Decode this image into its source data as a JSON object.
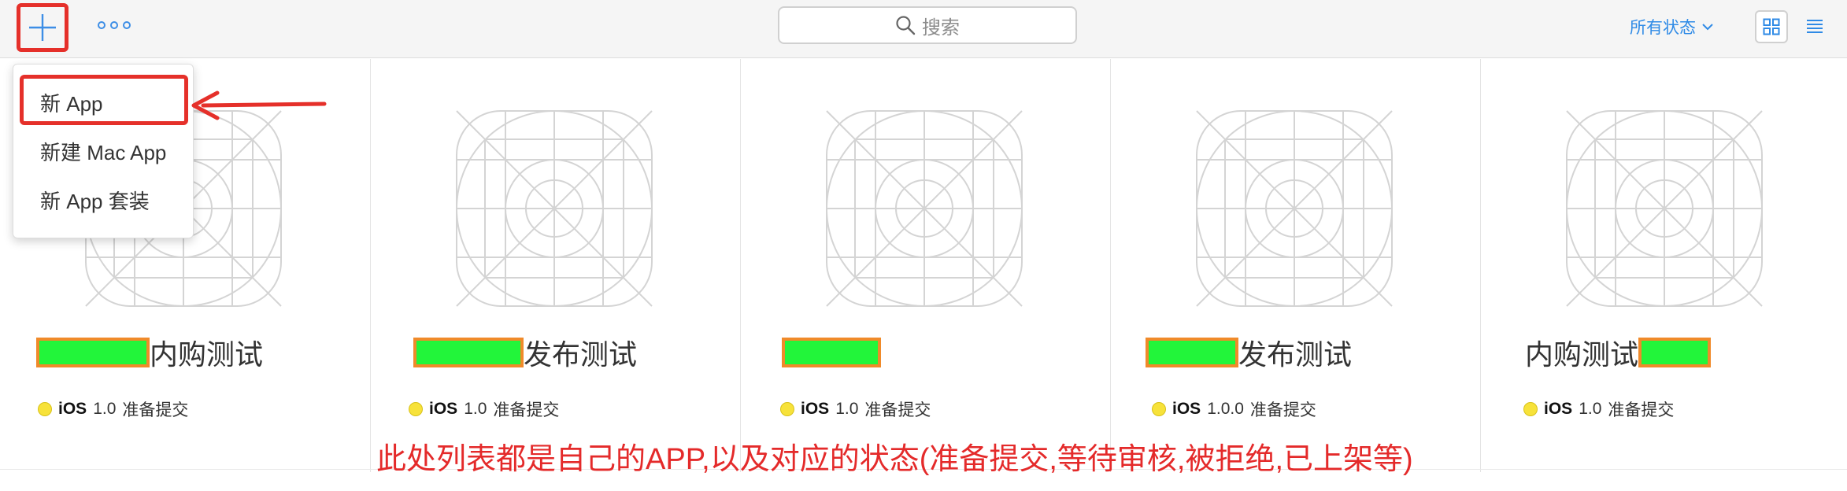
{
  "toolbar": {
    "search_placeholder": "搜索",
    "status_filter_label": "所有状态"
  },
  "new_menu": {
    "items": [
      "新 App",
      "新建 Mac App",
      "新 App 套装"
    ],
    "highlighted_index": 0
  },
  "apps": [
    {
      "name_suffix": "内购测试",
      "platform": "iOS",
      "version": "1.0",
      "status": "准备提交"
    },
    {
      "name_suffix": "发布测试",
      "platform": "iOS",
      "version": "1.0",
      "status": "准备提交"
    },
    {
      "name_suffix": "",
      "platform": "iOS",
      "version": "1.0",
      "status": "准备提交"
    },
    {
      "name_suffix": "发布测试",
      "platform": "iOS",
      "version": "1.0.0",
      "status": "准备提交"
    },
    {
      "name_prefix": "内购测试",
      "platform": "iOS",
      "version": "1.0",
      "status": "准备提交"
    }
  ],
  "annotation": {
    "caption": "此处列表都是自己的APP,以及对应的状态(准备提交,等待审核,被拒绝,已上架等)"
  },
  "colors": {
    "accent": "#2e8ae6",
    "annotation_red": "#e42a2a",
    "status_yellow": "#f7e23a",
    "redaction_green": "#22f53a"
  }
}
